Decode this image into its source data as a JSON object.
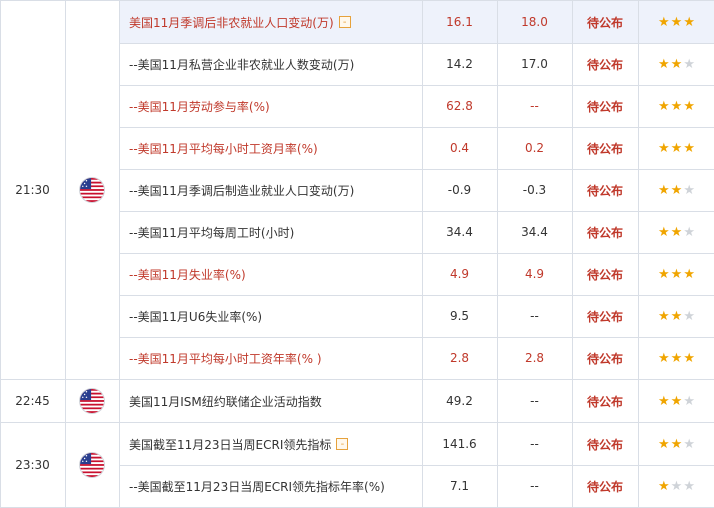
{
  "status_label": "待公布",
  "colors": {
    "accent_red": "#c0392b",
    "star": "#f0a500",
    "star_off": "#cfd3d8",
    "highlight": "#eef2fb",
    "grid": "#d9dee6"
  },
  "icons": {
    "flag": "us-flag-icon",
    "expand": "expand-toggle-icon",
    "star": "star-icon"
  },
  "groups": [
    {
      "time": "21:30",
      "country": "美国",
      "rows": [
        {
          "name": "美国11月季调后非农就业人口变动(万)",
          "prev": "16.1",
          "forecast": "18.0",
          "stars": 3,
          "red": true,
          "toggle": "-",
          "highlight": true
        },
        {
          "name": "--美国11月私营企业非农就业人数变动(万)",
          "prev": "14.2",
          "forecast": "17.0",
          "stars": 2,
          "red": false
        },
        {
          "name": "--美国11月劳动参与率(%)",
          "prev": "62.8",
          "forecast": "--",
          "stars": 3,
          "red": true
        },
        {
          "name": "--美国11月平均每小时工资月率(%)",
          "prev": "0.4",
          "forecast": "0.2",
          "stars": 3,
          "red": true
        },
        {
          "name": "--美国11月季调后制造业就业人口变动(万)",
          "prev": "-0.9",
          "forecast": "-0.3",
          "stars": 2,
          "red": false
        },
        {
          "name": "--美国11月平均每周工时(小时)",
          "prev": "34.4",
          "forecast": "34.4",
          "stars": 2,
          "red": false
        },
        {
          "name": "--美国11月失业率(%)",
          "prev": "4.9",
          "forecast": "4.9",
          "stars": 3,
          "red": true
        },
        {
          "name": "--美国11月U6失业率(%)",
          "prev": "9.5",
          "forecast": "--",
          "stars": 2,
          "red": false
        },
        {
          "name": "--美国11月平均每小时工资年率(% )",
          "prev": "2.8",
          "forecast": "2.8",
          "stars": 3,
          "red": true
        }
      ]
    },
    {
      "time": "22:45",
      "country": "美国",
      "rows": [
        {
          "name": "美国11月ISM纽约联储企业活动指数",
          "prev": "49.2",
          "forecast": "--",
          "stars": 2,
          "red": false
        }
      ]
    },
    {
      "time": "23:30",
      "country": "美国",
      "rows": [
        {
          "name": "美国截至11月23日当周ECRI领先指标",
          "prev": "141.6",
          "forecast": "--",
          "stars": 2,
          "red": false,
          "toggle": "-"
        },
        {
          "name": "--美国截至11月23日当周ECRI领先指标年率(%)",
          "prev": "7.1",
          "forecast": "--",
          "stars": 1,
          "red": false
        }
      ]
    }
  ]
}
